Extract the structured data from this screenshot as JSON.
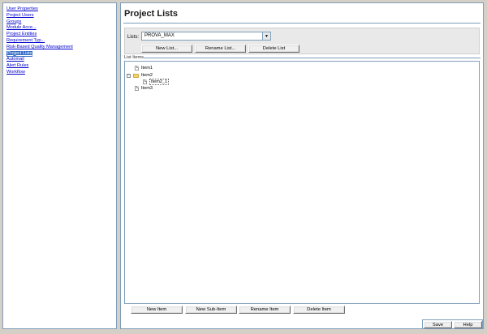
{
  "sidebar": {
    "items": [
      {
        "label": "User Properties",
        "active": false
      },
      {
        "label": "Project Users",
        "active": false
      },
      {
        "label": "Groups",
        "active": false
      },
      {
        "label": "Module Acce...",
        "active": false
      },
      {
        "label": "Project Entities",
        "active": false
      },
      {
        "label": "Requirement Typ...",
        "active": false
      },
      {
        "label": "Risk-Based Quality Management",
        "active": false
      },
      {
        "label": "Project Lists",
        "active": true
      },
      {
        "label": "Automail",
        "active": false
      },
      {
        "label": "Alert Rules",
        "active": false
      },
      {
        "label": "Workflow",
        "active": false
      }
    ]
  },
  "main": {
    "title": "Project Lists",
    "lists_label": "Lists:",
    "selected_list": "PROVA_MAX",
    "list_buttons": {
      "new": "New List...",
      "rename": "Rename List...",
      "delete": "Delete List"
    },
    "items_label": "List Items",
    "tree": [
      {
        "label": "Item1",
        "level": 0,
        "type": "item"
      },
      {
        "label": "Item2",
        "level": 0,
        "type": "folder",
        "expanded": true
      },
      {
        "label": "Item2_1",
        "level": 1,
        "type": "item",
        "selected": true
      },
      {
        "label": "Item3",
        "level": 0,
        "type": "item"
      }
    ],
    "item_buttons": {
      "new": "New Item",
      "new_sub": "New Sub-Item",
      "rename": "Rename Item",
      "delete": "Delete Item"
    }
  },
  "footer": {
    "save": "Save",
    "help": "Help"
  },
  "icons": {
    "toggle": "minus-square-icon",
    "folder": "folder-icon",
    "item": "document-icon",
    "dropdown": "chevron-down-icon"
  },
  "colors": {
    "link": "#0000cc",
    "active_bg": "#316ac5",
    "border": "#7f9db9",
    "panel_bg": "#d4d0c8"
  }
}
